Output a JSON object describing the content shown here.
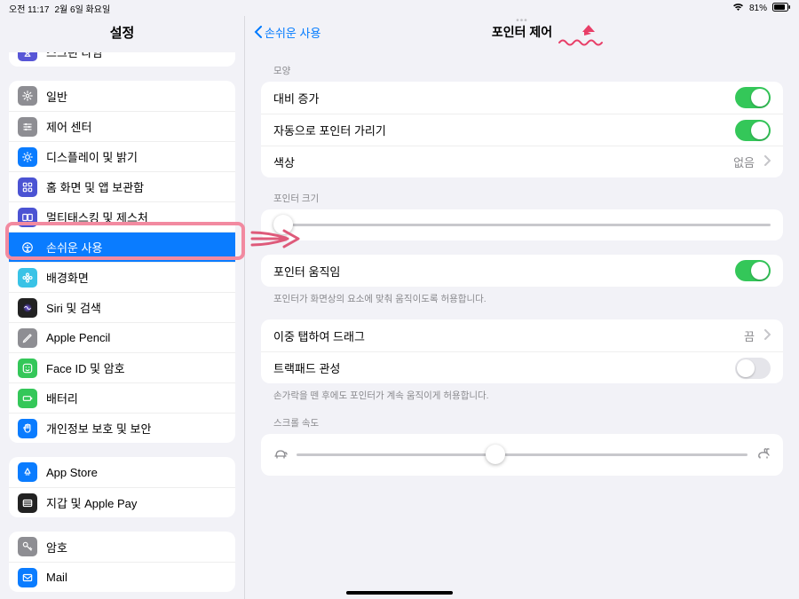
{
  "status": {
    "time": "오전 11:17",
    "date": "2월 6일 화요일",
    "battery_pct": "81%"
  },
  "sidebar": {
    "title": "설정",
    "groups": [
      {
        "items": [
          {
            "label": "스크린 타임",
            "icon": "hourglass",
            "bg": "#5856d6"
          }
        ]
      },
      {
        "items": [
          {
            "label": "일반",
            "icon": "gear",
            "bg": "#8e8e93"
          },
          {
            "label": "제어 센터",
            "icon": "sliders",
            "bg": "#8e8e93"
          },
          {
            "label": "디스플레이 및 밝기",
            "icon": "sun",
            "bg": "#0a7cff"
          },
          {
            "label": "홈 화면 및 앱 보관함",
            "icon": "grid",
            "bg": "#4b53d3"
          },
          {
            "label": "멀티태스킹 및 제스처",
            "icon": "rectangles",
            "bg": "#4b53d3"
          },
          {
            "label": "손쉬운 사용",
            "icon": "accessibility",
            "bg": "#0a7cff",
            "selected": true
          },
          {
            "label": "배경화면",
            "icon": "flower",
            "bg": "#39c3e6"
          },
          {
            "label": "Siri 및 검색",
            "icon": "siri",
            "bg": "#222"
          },
          {
            "label": "Apple Pencil",
            "icon": "pencil",
            "bg": "#8e8e93"
          },
          {
            "label": "Face ID 및 암호",
            "icon": "face",
            "bg": "#34c759"
          },
          {
            "label": "배터리",
            "icon": "battery",
            "bg": "#34c759"
          },
          {
            "label": "개인정보 보호 및 보안",
            "icon": "hand",
            "bg": "#0a7cff"
          }
        ]
      },
      {
        "items": [
          {
            "label": "App Store",
            "icon": "appstore",
            "bg": "#0a7cff"
          },
          {
            "label": "지갑 및 Apple Pay",
            "icon": "wallet",
            "bg": "#222"
          }
        ]
      },
      {
        "items": [
          {
            "label": "암호",
            "icon": "key",
            "bg": "#8e8e93"
          },
          {
            "label": "Mail",
            "icon": "mail",
            "bg": "#0a7cff"
          }
        ]
      }
    ]
  },
  "detail": {
    "back_label": "손쉬운 사용",
    "title": "포인터 제어",
    "sec_appearance": "모양",
    "row_contrast": "대비 증가",
    "row_autohide": "자동으로 포인터 가리기",
    "row_color": "색상",
    "row_color_value": "없음",
    "sec_pointer_size": "포인터 크기",
    "pointer_size_pos": 0.02,
    "row_animation": "포인터 움직임",
    "foot_animation": "포인터가 화면상의 요소에 맞춰 움직이도록 허용합니다.",
    "row_doubletap": "이중 탭하여 드래그",
    "row_doubletap_value": "끔",
    "row_inertia": "트랙패드 관성",
    "foot_inertia": "손가락을 뗀 후에도 포인터가 계속 움직이게 허용합니다.",
    "sec_scroll_speed": "스크롤 속도",
    "scroll_speed_pos": 0.44,
    "toggles": {
      "contrast": true,
      "autohide": true,
      "animation": true,
      "inertia": false
    }
  }
}
